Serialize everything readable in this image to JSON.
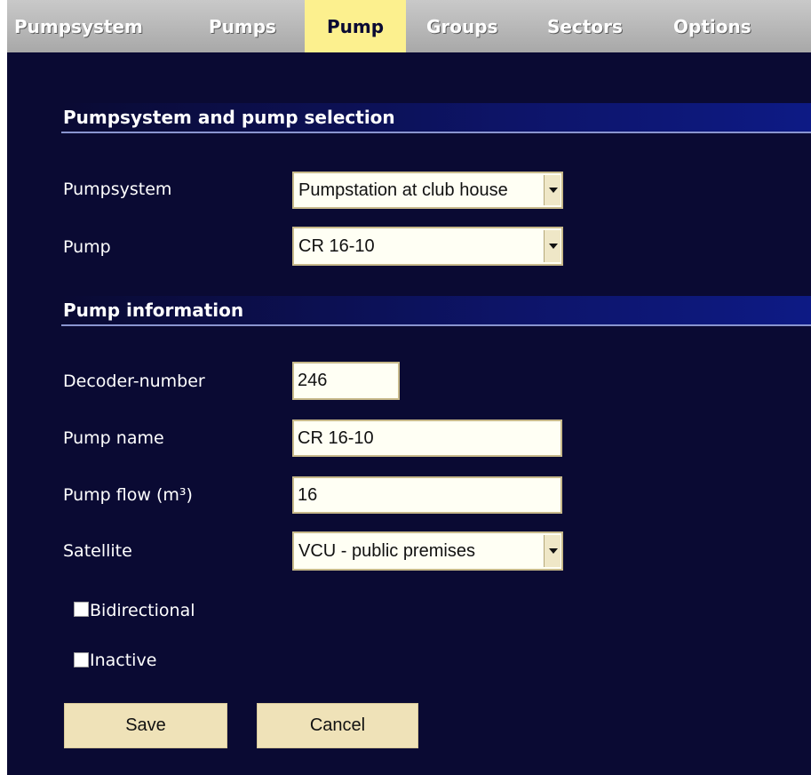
{
  "tabs": [
    {
      "label": "Pumpsystem"
    },
    {
      "label": "Pumps"
    },
    {
      "label": "Pump"
    },
    {
      "label": "Groups"
    },
    {
      "label": "Sectors"
    },
    {
      "label": "Options"
    }
  ],
  "active_tab": "Pump",
  "sections": {
    "selection_title": "Pumpsystem and pump selection",
    "info_title": "Pump information"
  },
  "selection": {
    "pumpsystem_label": "Pumpsystem",
    "pumpsystem_value": "Pumpstation at club house",
    "pump_label": "Pump",
    "pump_value": "CR 16-10"
  },
  "info": {
    "decoder_label": "Decoder-number",
    "decoder_value": "246",
    "name_label": "Pump name",
    "name_value": "CR 16-10",
    "flow_label": "Pump flow (m³)",
    "flow_value": "16",
    "satellite_label": "Satellite",
    "satellite_value": "VCU - public premises"
  },
  "options": {
    "bidirectional_label": "Bidirectional",
    "bidirectional_checked": false,
    "inactive_label": "Inactive",
    "inactive_checked": false
  },
  "buttons": {
    "save": "Save",
    "cancel": "Cancel"
  },
  "colors": {
    "background": "#0a0a33",
    "tab_bar": "#b5b5b5",
    "active_tab": "#fcf08e",
    "section_header": "#0d1a85",
    "button": "#efe2b8"
  }
}
